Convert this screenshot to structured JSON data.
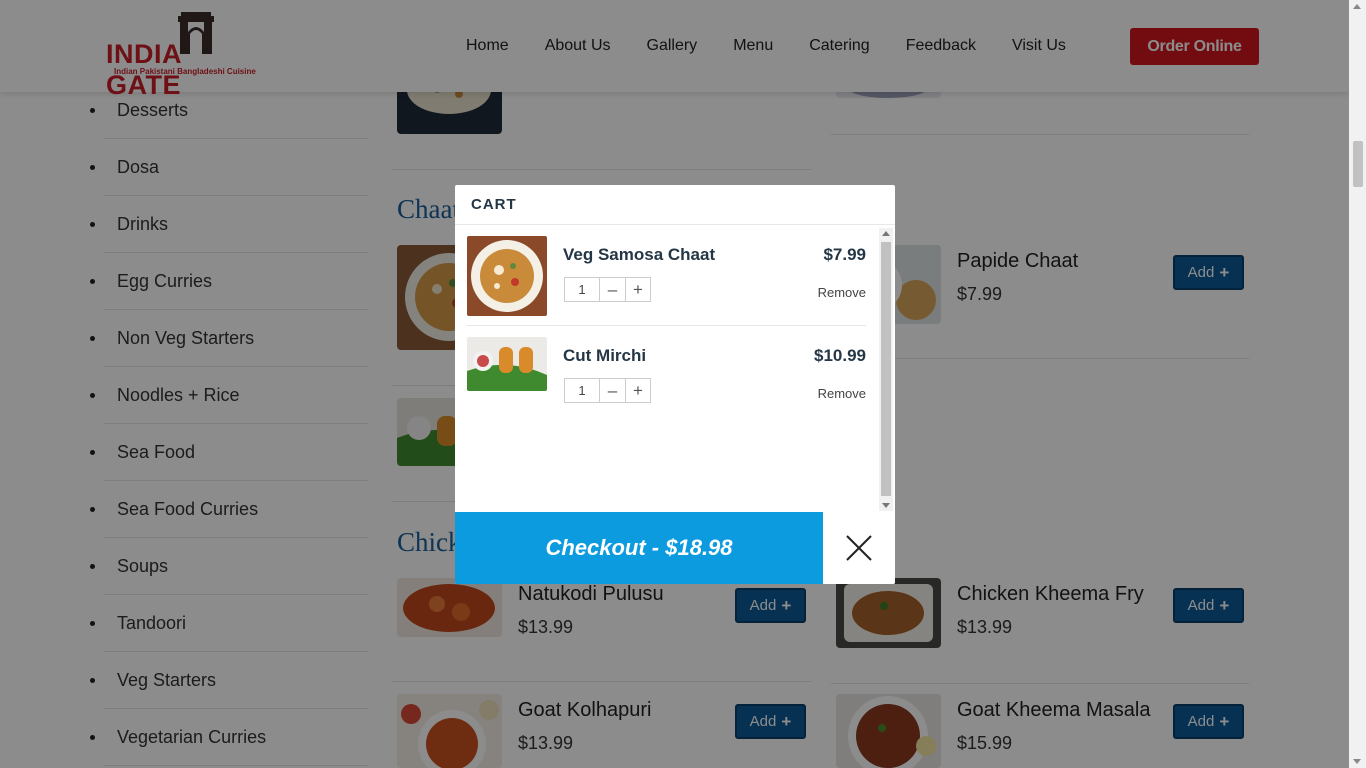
{
  "header": {
    "logo": {
      "text_left": "INDIA",
      "text_right": "GATE",
      "subtitle": "Indian Pakistani Bangladeshi Cuisine"
    },
    "nav": [
      "Home",
      "About Us",
      "Gallery",
      "Menu",
      "Catering",
      "Feedback",
      "Visit Us"
    ],
    "order_button": "Order Online"
  },
  "sidebar": {
    "categories": [
      "Desserts",
      "Dosa",
      "Drinks",
      "Egg Curries",
      "Non Veg Starters",
      "Noodles + Rice",
      "Sea Food",
      "Sea Food Curries",
      "Soups",
      "Tandoori",
      "Veg Starters",
      "Vegetarian Curries"
    ]
  },
  "menu": {
    "sections": [
      {
        "title": "Chaat"
      },
      {
        "title": "Chicken"
      }
    ],
    "items": [
      {
        "name": "Papide Chaat",
        "price": "$7.99",
        "add": "Add"
      },
      {
        "name": "Natukodi Pulusu",
        "price": "$13.99",
        "add": "Add"
      },
      {
        "name": "Chicken Kheema Fry",
        "price": "$13.99",
        "add": "Add"
      },
      {
        "name": "Goat Kolhapuri",
        "price": "$13.99",
        "add": "Add"
      },
      {
        "name": "Goat Kheema Masala",
        "price": "$15.99",
        "add": "Add"
      }
    ]
  },
  "cart": {
    "title": "CART",
    "items": [
      {
        "name": "Veg Samosa Chaat",
        "price": "$7.99",
        "qty": "1",
        "remove": "Remove"
      },
      {
        "name": "Cut Mirchi",
        "price": "$10.99",
        "qty": "1",
        "remove": "Remove"
      }
    ],
    "checkout_label": "Checkout - $18.98"
  },
  "colors": {
    "brand_red": "#d1161f",
    "checkout_blue": "#0d9be0",
    "add_button_blue": "#0d5a96",
    "section_title_blue": "#1b5e98"
  },
  "icons": [
    "india-gate-logo-icon",
    "plus-icon",
    "minus-icon",
    "close-icon"
  ]
}
